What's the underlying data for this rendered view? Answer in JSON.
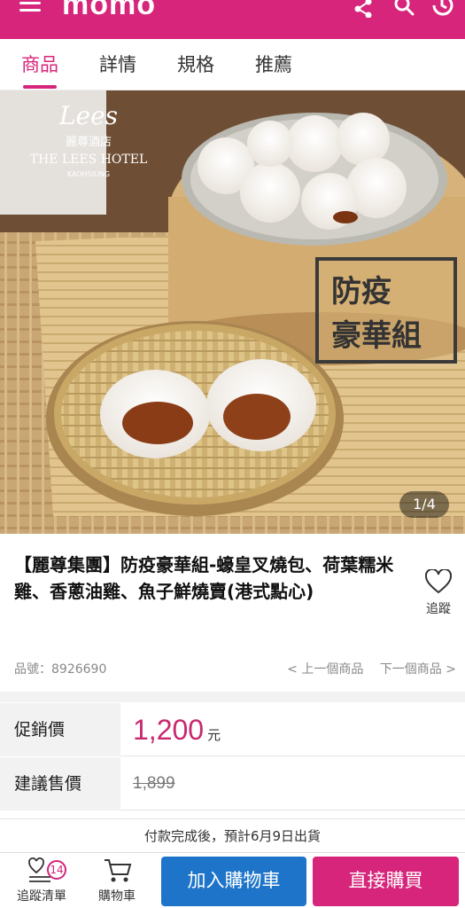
{
  "app": {
    "logo_text": "momo",
    "colors": {
      "brand": "#d6257a",
      "cart_button": "#1e74c8",
      "price": "#c8286e"
    }
  },
  "topbar": {
    "icons": [
      "menu-icon",
      "share-icon",
      "search-icon",
      "history-icon"
    ]
  },
  "tabs": [
    {
      "label": "商品",
      "active": true
    },
    {
      "label": "詳情",
      "active": false
    },
    {
      "label": "規格",
      "active": false
    },
    {
      "label": "推薦",
      "active": false
    }
  ],
  "hero": {
    "hotel_script": "Lees",
    "hotel_cn": "麗尊酒店",
    "hotel_en": "THE LEES HOTEL",
    "hotel_city": "KAOHSIUNG",
    "stamp_line1": "防疫",
    "stamp_line2": "豪華組",
    "page_counter": "1/4"
  },
  "product": {
    "title": "【麗尊集團】防疫豪華組-蠔皇叉燒包、荷葉糯米雞、香蔥油雞、魚子鮮燒賣(港式點心)",
    "favorite_label": "追蹤",
    "product_no": "品號：8926690",
    "prev_label": "< 上一個商品",
    "next_label": "下一個商品 >"
  },
  "price": {
    "promo_label": "促銷價",
    "promo_value": "1,200",
    "currency": "元",
    "suggested_label": "建議售價",
    "suggested_value": "1,899"
  },
  "shipping_notice": "付款完成後，預計6月9日出貨",
  "bottombar": {
    "wishlist_label": "追蹤清單",
    "wishlist_count": "14",
    "cart_label": "購物車",
    "add_to_cart": "加入購物車",
    "buy_now": "直接購買"
  }
}
